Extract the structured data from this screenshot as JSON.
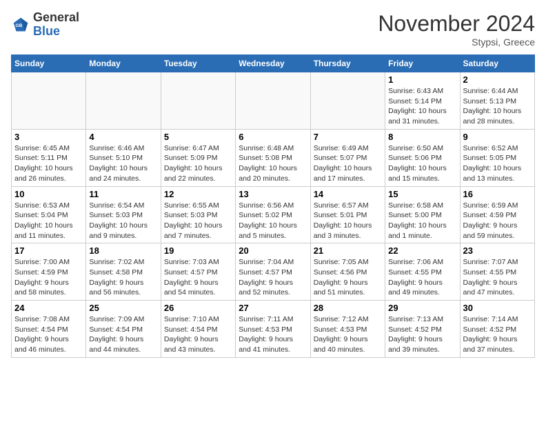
{
  "header": {
    "logo_line1": "General",
    "logo_line2": "Blue",
    "month_title": "November 2024",
    "subtitle": "Stypsi, Greece"
  },
  "weekdays": [
    "Sunday",
    "Monday",
    "Tuesday",
    "Wednesday",
    "Thursday",
    "Friday",
    "Saturday"
  ],
  "weeks": [
    [
      {
        "day": "",
        "info": ""
      },
      {
        "day": "",
        "info": ""
      },
      {
        "day": "",
        "info": ""
      },
      {
        "day": "",
        "info": ""
      },
      {
        "day": "",
        "info": ""
      },
      {
        "day": "1",
        "info": "Sunrise: 6:43 AM\nSunset: 5:14 PM\nDaylight: 10 hours\nand 31 minutes."
      },
      {
        "day": "2",
        "info": "Sunrise: 6:44 AM\nSunset: 5:13 PM\nDaylight: 10 hours\nand 28 minutes."
      }
    ],
    [
      {
        "day": "3",
        "info": "Sunrise: 6:45 AM\nSunset: 5:11 PM\nDaylight: 10 hours\nand 26 minutes."
      },
      {
        "day": "4",
        "info": "Sunrise: 6:46 AM\nSunset: 5:10 PM\nDaylight: 10 hours\nand 24 minutes."
      },
      {
        "day": "5",
        "info": "Sunrise: 6:47 AM\nSunset: 5:09 PM\nDaylight: 10 hours\nand 22 minutes."
      },
      {
        "day": "6",
        "info": "Sunrise: 6:48 AM\nSunset: 5:08 PM\nDaylight: 10 hours\nand 20 minutes."
      },
      {
        "day": "7",
        "info": "Sunrise: 6:49 AM\nSunset: 5:07 PM\nDaylight: 10 hours\nand 17 minutes."
      },
      {
        "day": "8",
        "info": "Sunrise: 6:50 AM\nSunset: 5:06 PM\nDaylight: 10 hours\nand 15 minutes."
      },
      {
        "day": "9",
        "info": "Sunrise: 6:52 AM\nSunset: 5:05 PM\nDaylight: 10 hours\nand 13 minutes."
      }
    ],
    [
      {
        "day": "10",
        "info": "Sunrise: 6:53 AM\nSunset: 5:04 PM\nDaylight: 10 hours\nand 11 minutes."
      },
      {
        "day": "11",
        "info": "Sunrise: 6:54 AM\nSunset: 5:03 PM\nDaylight: 10 hours\nand 9 minutes."
      },
      {
        "day": "12",
        "info": "Sunrise: 6:55 AM\nSunset: 5:03 PM\nDaylight: 10 hours\nand 7 minutes."
      },
      {
        "day": "13",
        "info": "Sunrise: 6:56 AM\nSunset: 5:02 PM\nDaylight: 10 hours\nand 5 minutes."
      },
      {
        "day": "14",
        "info": "Sunrise: 6:57 AM\nSunset: 5:01 PM\nDaylight: 10 hours\nand 3 minutes."
      },
      {
        "day": "15",
        "info": "Sunrise: 6:58 AM\nSunset: 5:00 PM\nDaylight: 10 hours\nand 1 minute."
      },
      {
        "day": "16",
        "info": "Sunrise: 6:59 AM\nSunset: 4:59 PM\nDaylight: 9 hours\nand 59 minutes."
      }
    ],
    [
      {
        "day": "17",
        "info": "Sunrise: 7:00 AM\nSunset: 4:59 PM\nDaylight: 9 hours\nand 58 minutes."
      },
      {
        "day": "18",
        "info": "Sunrise: 7:02 AM\nSunset: 4:58 PM\nDaylight: 9 hours\nand 56 minutes."
      },
      {
        "day": "19",
        "info": "Sunrise: 7:03 AM\nSunset: 4:57 PM\nDaylight: 9 hours\nand 54 minutes."
      },
      {
        "day": "20",
        "info": "Sunrise: 7:04 AM\nSunset: 4:57 PM\nDaylight: 9 hours\nand 52 minutes."
      },
      {
        "day": "21",
        "info": "Sunrise: 7:05 AM\nSunset: 4:56 PM\nDaylight: 9 hours\nand 51 minutes."
      },
      {
        "day": "22",
        "info": "Sunrise: 7:06 AM\nSunset: 4:55 PM\nDaylight: 9 hours\nand 49 minutes."
      },
      {
        "day": "23",
        "info": "Sunrise: 7:07 AM\nSunset: 4:55 PM\nDaylight: 9 hours\nand 47 minutes."
      }
    ],
    [
      {
        "day": "24",
        "info": "Sunrise: 7:08 AM\nSunset: 4:54 PM\nDaylight: 9 hours\nand 46 minutes."
      },
      {
        "day": "25",
        "info": "Sunrise: 7:09 AM\nSunset: 4:54 PM\nDaylight: 9 hours\nand 44 minutes."
      },
      {
        "day": "26",
        "info": "Sunrise: 7:10 AM\nSunset: 4:54 PM\nDaylight: 9 hours\nand 43 minutes."
      },
      {
        "day": "27",
        "info": "Sunrise: 7:11 AM\nSunset: 4:53 PM\nDaylight: 9 hours\nand 41 minutes."
      },
      {
        "day": "28",
        "info": "Sunrise: 7:12 AM\nSunset: 4:53 PM\nDaylight: 9 hours\nand 40 minutes."
      },
      {
        "day": "29",
        "info": "Sunrise: 7:13 AM\nSunset: 4:52 PM\nDaylight: 9 hours\nand 39 minutes."
      },
      {
        "day": "30",
        "info": "Sunrise: 7:14 AM\nSunset: 4:52 PM\nDaylight: 9 hours\nand 37 minutes."
      }
    ]
  ]
}
